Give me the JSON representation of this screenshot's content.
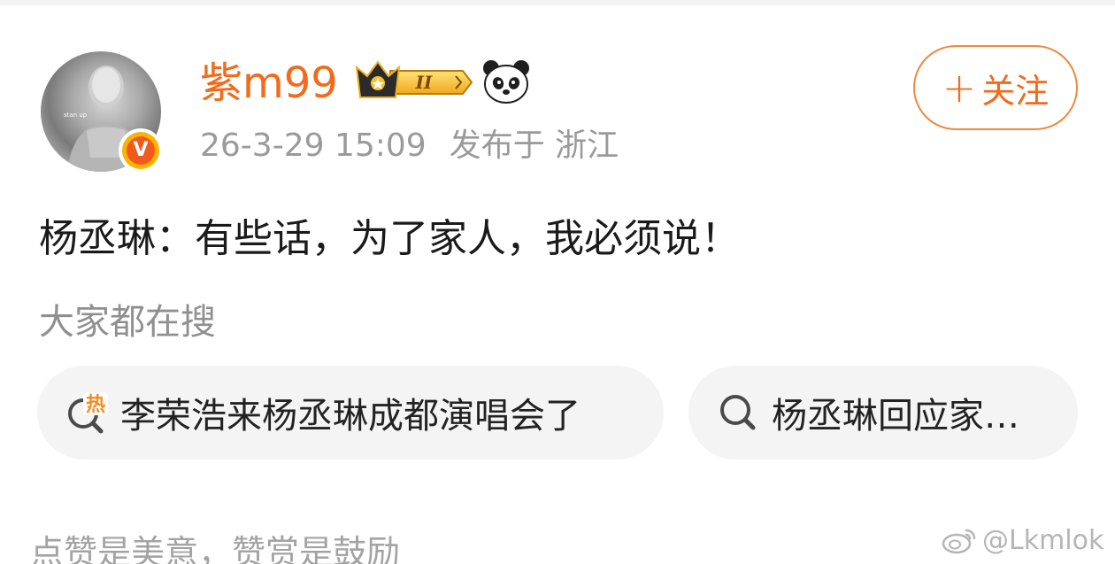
{
  "post": {
    "author": {
      "username": "紫m99",
      "badge_level": "II",
      "verified_mark": "V",
      "avatar_text": "stan up"
    },
    "timestamp": "26-3-29 15:09",
    "location": "发布于 浙江",
    "follow_label": "关注",
    "text": "杨丞琳：有些话，为了家人，我必须说！"
  },
  "trending": {
    "title": "大家都在搜",
    "chips": [
      {
        "label": "李荣浩来杨丞琳成都演唱会了",
        "icon": "hot-search-icon",
        "hot_text": "热"
      },
      {
        "label": "杨丞琳回应家…",
        "icon": "search-icon"
      }
    ]
  },
  "footer": {
    "reward_text": "点赞是美意，赞赏是鼓励"
  },
  "watermark": {
    "text": "@Lkmlok"
  },
  "colors": {
    "brand_orange": "#f26a1b",
    "meta_gray": "#9a9a9a",
    "chip_bg": "#f4f4f4"
  }
}
